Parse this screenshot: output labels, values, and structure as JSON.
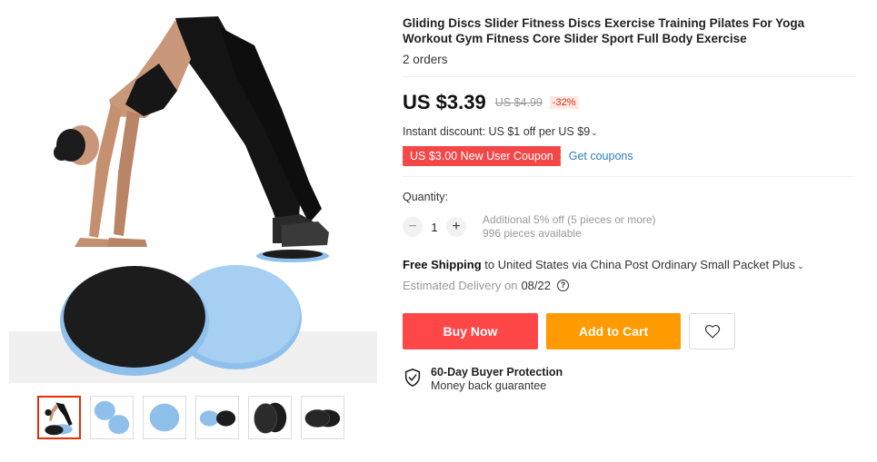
{
  "product": {
    "title": "Gliding Discs Slider Fitness Discs Exercise Training Pilates For Yoga Workout Gym Fitness Core Slider Sport Full Body Exercise",
    "orders": "2 orders"
  },
  "price": {
    "current": "US $3.39",
    "original": "US $4.99",
    "discount": "-32%"
  },
  "promotion": {
    "instant_discount": "Instant discount: US $1 off per US $9",
    "coupon": "US $3.00 New User Coupon",
    "get_coupons": "Get coupons"
  },
  "quantity": {
    "label": "Quantity:",
    "value": "1",
    "minus": "−",
    "plus": "+",
    "additional": "Additional 5% off (5 pieces or more)",
    "available": "996 pieces available"
  },
  "shipping": {
    "free": "Free Shipping",
    "detail": "to United States via China Post Ordinary Small Packet Plus",
    "estimated_label": "Estimated Delivery on",
    "estimated_date": "08/22"
  },
  "actions": {
    "buy_now": "Buy Now",
    "add_to_cart": "Add to Cart"
  },
  "protection": {
    "title": "60-Day Buyer Protection",
    "subtitle": "Money back guarantee"
  },
  "icons": {
    "wishlist": "heart-icon",
    "protection": "shield-check-icon",
    "help": "question-circle-icon",
    "dropdown": "chevron-down-icon"
  },
  "colors": {
    "buy_now": "#ff4747",
    "add_to_cart": "#ff9a00",
    "coupon": "#f44848",
    "link": "#2b7fb5",
    "disc_blue": "#8fc0ec",
    "disc_black": "#1c1c1c"
  },
  "gallery": {
    "thumbnails": [
      "model-with-discs",
      "two-blue-discs",
      "single-blue-disc",
      "blue-and-black-discs",
      "two-black-discs-angled",
      "two-black-discs-overlap"
    ],
    "active_index": 0
  }
}
